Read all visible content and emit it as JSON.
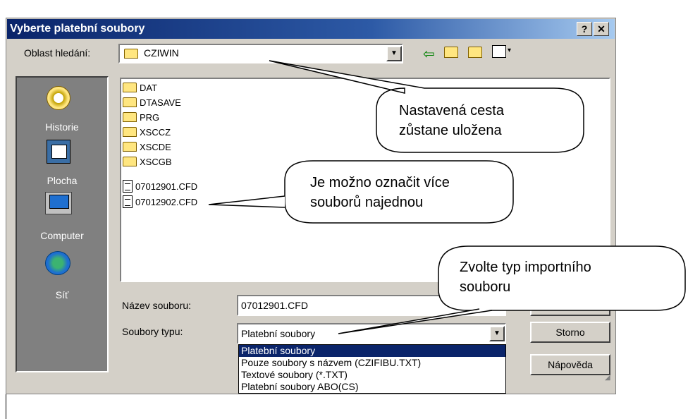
{
  "window": {
    "title": "Vyberte platební soubory",
    "help_btn": "?",
    "close_btn": "✕"
  },
  "lookin": {
    "label": "Oblast hledání:",
    "value": "CZIWIN"
  },
  "places": [
    {
      "label": "Historie",
      "icon": "history-icon"
    },
    {
      "label": "Plocha",
      "icon": "desktop-icon"
    },
    {
      "label": "Computer",
      "icon": "computer-icon"
    },
    {
      "label": "Síť",
      "icon": "network-icon"
    }
  ],
  "files": [
    {
      "name": "DAT",
      "type": "folder"
    },
    {
      "name": "DTASAVE",
      "type": "folder"
    },
    {
      "name": "PRG",
      "type": "folder"
    },
    {
      "name": "XSCCZ",
      "type": "folder"
    },
    {
      "name": "XSCDE",
      "type": "folder"
    },
    {
      "name": "XSCGB",
      "type": "folder"
    },
    {
      "name": "07012901.CFD",
      "type": "file"
    },
    {
      "name": "07012902.CFD",
      "type": "file"
    }
  ],
  "filename": {
    "label": "Název souboru:",
    "value": "07012901.CFD"
  },
  "filetype": {
    "label": "Soubory typu:",
    "value": "Platební soubory",
    "options": [
      "Platební soubory",
      "Pouze soubory s názvem (CZIFIBU.TXT)",
      "Textové soubory (*.TXT)",
      "Platební soubory ABO(CS)"
    ]
  },
  "buttons": {
    "cancel": "Storno",
    "help": "Nápověda"
  },
  "callouts": {
    "c1_line1": "Nastavená cesta",
    "c1_line2": "zůstane uložena",
    "c2_line1": "Je možno označit více",
    "c2_line2": "souborů najednou",
    "c3_line1": "Zvolte typ importního",
    "c3_line2": "souboru"
  },
  "colors": {
    "titlebar": "#0a246a",
    "dialog": "#d4d0c8",
    "selection": "#0a246a"
  }
}
